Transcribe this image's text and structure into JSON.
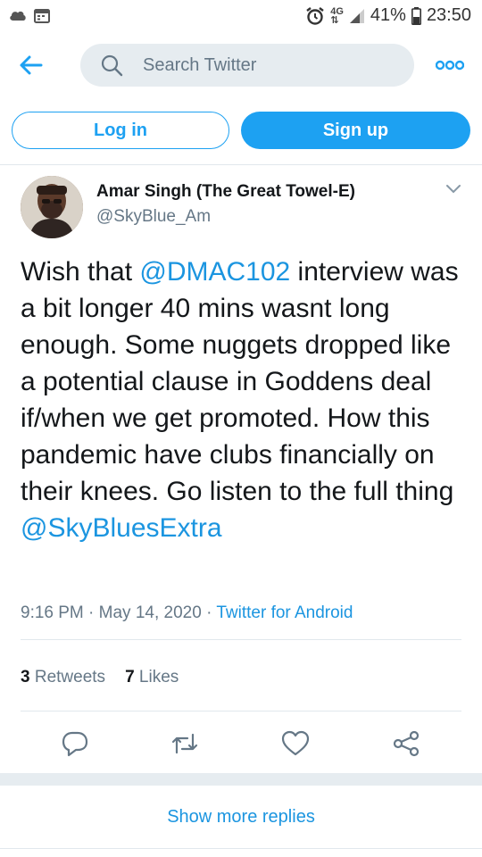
{
  "status_bar": {
    "network_4g": "4G",
    "battery_pct": "41%",
    "time": "23:50",
    "icons": [
      "cloud-icon",
      "calendar-icon",
      "alarm-icon",
      "network-icon",
      "signal-icon",
      "battery-icon"
    ]
  },
  "header": {
    "search_placeholder": "Search Twitter",
    "icons": [
      "back-arrow-icon",
      "search-icon",
      "more-icon"
    ]
  },
  "auth": {
    "login_label": "Log in",
    "signup_label": "Sign up"
  },
  "tweet": {
    "author_name": "Amar Singh (The Great Towel-E)",
    "author_handle": "@SkyBlue_Am",
    "text_pre": "Wish that ",
    "mention_1": "@DMAC102",
    "text_mid": " interview was a bit longer 40 mins wasnt long enough. Some nuggets dropped like a potential clause in Goddens deal if/when we get promoted. How this pandemic have clubs financially on their knees. Go listen to the full thing ",
    "mention_2": "@SkyBluesExtra",
    "time": "9:16 PM",
    "sep": "·",
    "date": "May 14, 2020",
    "source": "Twitter for Android",
    "retweets_count": "3",
    "retweets_label": "Retweets",
    "likes_count": "7",
    "likes_label": "Likes"
  },
  "actions": [
    "reply-icon",
    "retweet-icon",
    "like-icon",
    "share-icon"
  ],
  "show_more_label": "Show more replies",
  "colors": {
    "accent": "#1da1f2",
    "link": "#1b95e0",
    "muted": "#657786",
    "divider": "#e1e8ed",
    "search_bg": "#e6ecf0"
  }
}
